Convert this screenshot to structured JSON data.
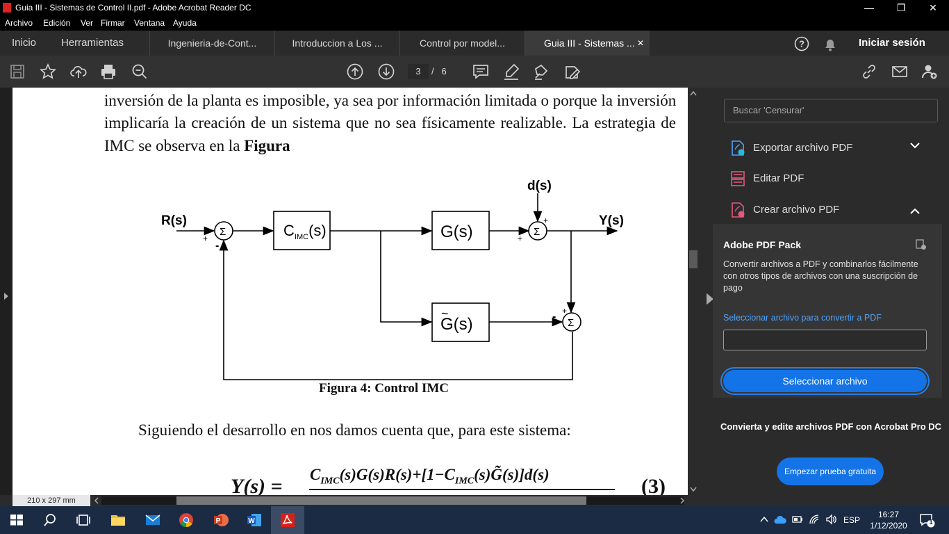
{
  "window": {
    "title": "Guia III - Sistemas de Control II.pdf - Adobe Acrobat Reader DC",
    "minimize": "—",
    "restore": "❐",
    "close": "✕"
  },
  "menu": [
    "Archivo",
    "Edición",
    "Ver",
    "Firmar",
    "Ventana",
    "Ayuda"
  ],
  "tabs": {
    "home": "Inicio",
    "tools": "Herramientas",
    "documents": [
      "Ingenieria-de-Cont...",
      "Introduccion a Los ...",
      "Control por model...",
      "Guia III - Sistemas ..."
    ],
    "close_tab": "✕",
    "sign_in": "Iniciar sesión"
  },
  "toolbar": {
    "current_page": "3",
    "page_separator": "/",
    "total_pages": "6"
  },
  "document": {
    "line1": "inversión de la planta es imposible, ya sea por información limitada o porque la inversión",
    "line2": "implicaría la creación de un sistema que no sea físicamente realizable. La estrategia de",
    "line3_a": "IMC se observa en la ",
    "line3_b": "Figura",
    "figure_caption": "Figura 4: Control IMC",
    "paragraph": "Siguiendo el desarrollo en nos damos cuenta que, para este sistema:",
    "equation_lhs": "Y(s) =",
    "equation_numerator": "C",
    "equation_numerator_sub": "IMC",
    "equation_numerator_rest": "(s)G(s)R(s)+[1−C",
    "equation_numerator_sub2": "IMC",
    "equation_numerator_rest2": "(s)G̃(s)]d(s)",
    "equation_number": "(3)",
    "diagram": {
      "input": "R(s)",
      "disturbance": "d(s)",
      "output": "Y(s)",
      "controller": "C",
      "controller_sub": "IMC",
      "controller_arg": "(s)",
      "plant": "G(s)",
      "model": "G(s)",
      "model_tilde": "~",
      "sum": "Σ",
      "plus": "+",
      "minus": "-"
    }
  },
  "statusbar": {
    "page_size": "210 x 297 mm"
  },
  "right_panel": {
    "search_placeholder": "Buscar 'Censurar'",
    "tools": [
      {
        "label": "Exportar archivo PDF",
        "expand": "⌄"
      },
      {
        "label": "Editar PDF"
      },
      {
        "label": "Crear archivo PDF",
        "expand": "⌃"
      }
    ],
    "pack": {
      "title": "Adobe PDF Pack",
      "description": "Convertir archivos a PDF y combinarlos fácilmente con otros tipos de archivos con una suscripción de pago",
      "select_link": "Seleccionar archivo para convertir a PDF",
      "select_button": "Seleccionar archivo"
    },
    "promo": "Convierta y edite archivos PDF con Acrobat Pro DC",
    "trial_button": "Empezar prueba gratuita"
  },
  "taskbar": {
    "language": "ESP",
    "time": "16:27",
    "date": "1/12/2020",
    "notification_count": "1"
  },
  "colors": {
    "accent": "#1473e6",
    "link": "#4da3ff",
    "chrome": "#2b2b2b",
    "taskbar": "#1b2b44"
  }
}
